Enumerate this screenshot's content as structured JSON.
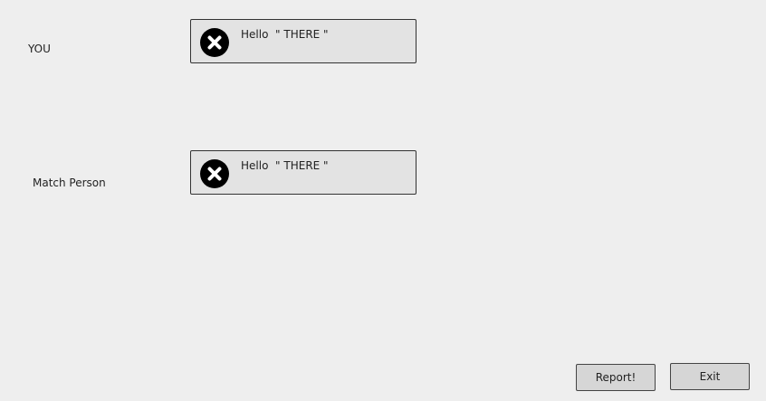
{
  "rows": [
    {
      "label": "YOU",
      "message": "Hello  \" THERE \"",
      "icon": "close-circle-icon"
    },
    {
      "label": "Match Person",
      "message": "Hello  \" THERE \"",
      "icon": "close-circle-icon"
    }
  ],
  "actions": {
    "report_label": "Report!",
    "exit_label": "Exit"
  },
  "colors": {
    "background": "#eeeeee",
    "message_box": "#e3e3e3",
    "button": "#d6d6d6",
    "icon": "#000000"
  }
}
